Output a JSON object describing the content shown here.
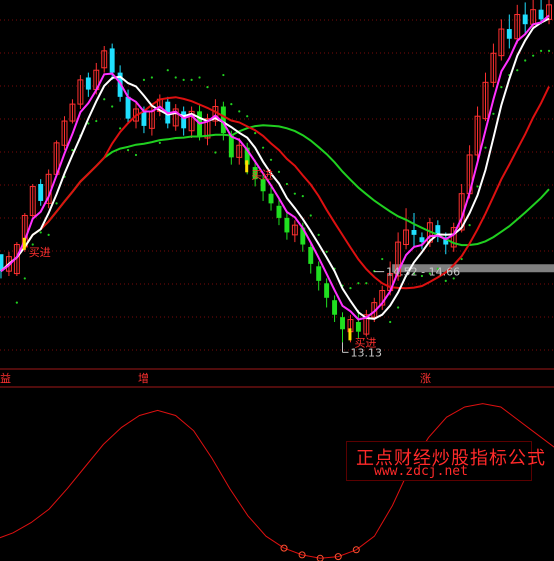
{
  "chart_data": [
    {
      "type": "candlestick",
      "title": "",
      "ylim": [
        12.6,
        20.2
      ],
      "grid": "dotted red horizontal",
      "colors": {
        "up": "#ff3030",
        "down": "#20e0ff",
        "down_phase2": "#20e020",
        "ma_white": "#ffffff",
        "ma_magenta": "#ff30ff",
        "ma_red": "#dd1010",
        "ma_green": "#20d020",
        "dots": "#20d020",
        "band": "#808080",
        "label": "#ff3030",
        "value_text": "#c8c8c8"
      },
      "candles": [
        [
          14.95,
          14.6,
          14.45,
          14.8
        ],
        [
          14.6,
          14.9,
          14.5,
          15.0
        ],
        [
          14.55,
          15.15,
          14.5,
          15.2
        ],
        [
          15.1,
          15.75,
          15.0,
          15.8
        ],
        [
          15.75,
          16.35,
          15.7,
          16.4
        ],
        [
          16.4,
          16.05,
          15.95,
          16.5
        ],
        [
          16.0,
          16.6,
          15.9,
          16.7
        ],
        [
          16.6,
          17.25,
          16.55,
          17.3
        ],
        [
          17.2,
          17.7,
          17.1,
          17.8
        ],
        [
          17.7,
          18.05,
          17.65,
          18.15
        ],
        [
          18.05,
          18.55,
          17.95,
          18.65
        ],
        [
          18.6,
          18.35,
          18.2,
          18.7
        ],
        [
          18.35,
          18.75,
          18.25,
          18.9
        ],
        [
          18.8,
          19.15,
          18.7,
          19.25
        ],
        [
          19.2,
          18.7,
          18.55,
          19.3
        ],
        [
          18.7,
          18.2,
          18.1,
          18.85
        ],
        [
          18.2,
          17.75,
          17.65,
          18.35
        ],
        [
          17.7,
          17.95,
          17.55,
          18.1
        ],
        [
          17.9,
          17.6,
          17.45,
          18.0
        ],
        [
          17.55,
          17.9,
          17.4,
          18.05
        ],
        [
          17.9,
          18.15,
          17.8,
          18.25
        ],
        [
          18.1,
          17.65,
          17.55,
          18.2
        ],
        [
          17.6,
          17.95,
          17.5,
          18.05
        ],
        [
          17.9,
          17.55,
          17.4,
          18.0
        ],
        [
          17.5,
          17.9,
          17.35,
          18.0
        ],
        [
          17.9,
          17.4,
          17.3,
          18.05
        ],
        [
          17.35,
          17.75,
          17.2,
          17.85
        ],
        [
          17.7,
          18.0,
          17.6,
          18.15
        ],
        [
          18.0,
          17.45,
          17.3,
          18.1
        ],
        [
          17.4,
          16.95,
          16.8,
          17.5
        ],
        [
          16.95,
          17.2,
          16.8,
          17.35
        ],
        [
          17.15,
          16.8,
          16.6,
          17.25
        ],
        [
          16.75,
          16.5,
          16.35,
          16.9
        ],
        [
          16.5,
          16.25,
          16.05,
          16.6
        ],
        [
          16.2,
          16.0,
          15.85,
          16.35
        ],
        [
          15.95,
          15.7,
          15.55,
          16.1
        ],
        [
          15.7,
          15.4,
          15.25,
          15.85
        ],
        [
          15.35,
          15.55,
          15.2,
          15.65
        ],
        [
          15.5,
          15.15,
          15.0,
          15.6
        ],
        [
          15.1,
          14.75,
          14.55,
          15.2
        ],
        [
          14.7,
          14.4,
          14.2,
          14.8
        ],
        [
          14.35,
          14.05,
          13.85,
          14.45
        ],
        [
          14.0,
          13.7,
          13.55,
          14.1
        ],
        [
          13.65,
          13.4,
          13.13,
          13.75
        ],
        [
          13.35,
          13.6,
          13.13,
          13.7
        ],
        [
          13.55,
          13.35,
          13.2,
          13.8
        ],
        [
          13.3,
          13.7,
          13.25,
          13.8
        ],
        [
          13.65,
          13.95,
          13.55,
          14.05
        ],
        [
          13.9,
          14.2,
          13.8,
          14.3
        ],
        [
          14.2,
          14.55,
          14.1,
          14.8
        ],
        [
          14.5,
          15.2,
          14.4,
          15.4
        ],
        [
          15.15,
          15.45,
          15.05,
          15.9
        ],
        [
          15.45,
          15.35,
          15.1,
          15.8
        ],
        [
          15.3,
          15.2,
          15.05,
          15.4
        ],
        [
          15.2,
          15.6,
          15.1,
          15.7
        ],
        [
          15.55,
          15.35,
          15.2,
          15.65
        ],
        [
          15.3,
          15.15,
          14.95,
          15.4
        ],
        [
          15.1,
          15.5,
          15.0,
          15.6
        ],
        [
          15.45,
          16.2,
          15.4,
          16.4
        ],
        [
          16.2,
          17.0,
          16.1,
          17.2
        ],
        [
          17.0,
          17.8,
          16.9,
          18.0
        ],
        [
          17.75,
          18.5,
          17.7,
          18.7
        ],
        [
          18.5,
          19.1,
          18.4,
          19.3
        ],
        [
          19.05,
          19.6,
          18.95,
          19.8
        ],
        [
          19.6,
          19.4,
          19.2,
          19.9
        ],
        [
          19.4,
          19.9,
          19.3,
          20.1
        ],
        [
          19.9,
          19.7,
          19.5,
          20.15
        ],
        [
          19.7,
          20.0,
          19.6,
          20.2
        ],
        [
          20.0,
          19.8,
          19.7,
          20.2
        ],
        [
          19.8,
          20.1,
          19.7,
          20.2
        ]
      ],
      "markers": [
        {
          "text": "买进",
          "candle": 3
        },
        {
          "text": "买进",
          "candle": 31
        },
        {
          "text": "买进",
          "candle": 44
        }
      ],
      "annotations": [
        {
          "text": "14.52 - 14.66",
          "value": 14.59
        },
        {
          "text": "13.13",
          "value": 13.13
        }
      ]
    },
    {
      "type": "line",
      "title": "",
      "ylim": [
        0,
        100
      ],
      "color": "#dd1010",
      "values": [
        12,
        16,
        22,
        30,
        42,
        55,
        68,
        78,
        85,
        88,
        85,
        76,
        60,
        42,
        26,
        14,
        7,
        3,
        1,
        2,
        6,
        14,
        32,
        55,
        72,
        84,
        90,
        92,
        90,
        82,
        74,
        66
      ]
    }
  ],
  "axis_labels": {
    "left": "益",
    "mid": "增",
    "right": "涨"
  },
  "watermark": {
    "title": "正点财经炒股指标公式",
    "url": "www.zdcj.net"
  }
}
